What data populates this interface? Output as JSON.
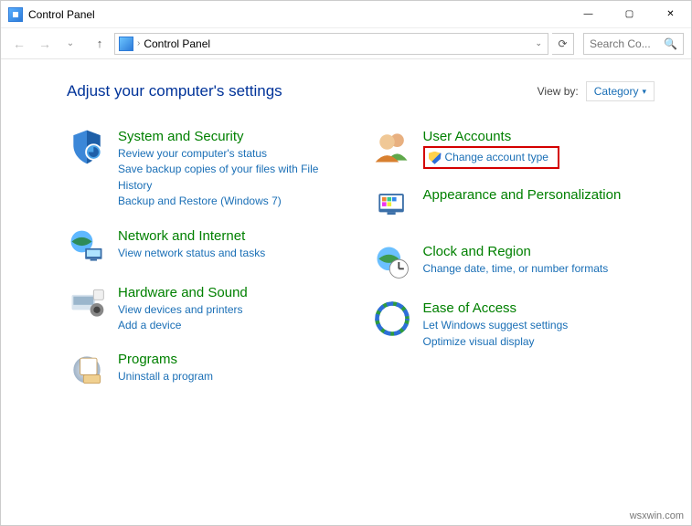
{
  "window": {
    "title": "Control Panel",
    "min": "—",
    "max": "▢",
    "close": "✕"
  },
  "nav": {
    "back": "←",
    "forward": "→",
    "up": "↑",
    "breadcrumb": "Control Panel",
    "sep": "›",
    "dropdown": "⌄",
    "refresh": "⟳",
    "search_placeholder": "Search Co..."
  },
  "page": {
    "heading": "Adjust your computer's settings",
    "viewby_label": "View by:",
    "viewby_value": "Category",
    "viewby_caret": "▾"
  },
  "categories": {
    "left": [
      {
        "id": "system-security",
        "title": "System and Security",
        "links": [
          "Review your computer's status",
          "Save backup copies of your files with File History",
          "Backup and Restore (Windows 7)"
        ]
      },
      {
        "id": "network-internet",
        "title": "Network and Internet",
        "links": [
          "View network status and tasks"
        ]
      },
      {
        "id": "hardware-sound",
        "title": "Hardware and Sound",
        "links": [
          "View devices and printers",
          "Add a device"
        ]
      },
      {
        "id": "programs",
        "title": "Programs",
        "links": [
          "Uninstall a program"
        ]
      }
    ],
    "right": [
      {
        "id": "user-accounts",
        "title": "User Accounts",
        "links": [
          "Change account type"
        ],
        "shield": true,
        "highlighted": true
      },
      {
        "id": "appearance-personalization",
        "title": "Appearance and Personalization",
        "links": []
      },
      {
        "id": "clock-region",
        "title": "Clock and Region",
        "links": [
          "Change date, time, or number formats"
        ]
      },
      {
        "id": "ease-of-access",
        "title": "Ease of Access",
        "links": [
          "Let Windows suggest settings",
          "Optimize visual display"
        ]
      }
    ]
  },
  "watermark": "wsxwin.com"
}
